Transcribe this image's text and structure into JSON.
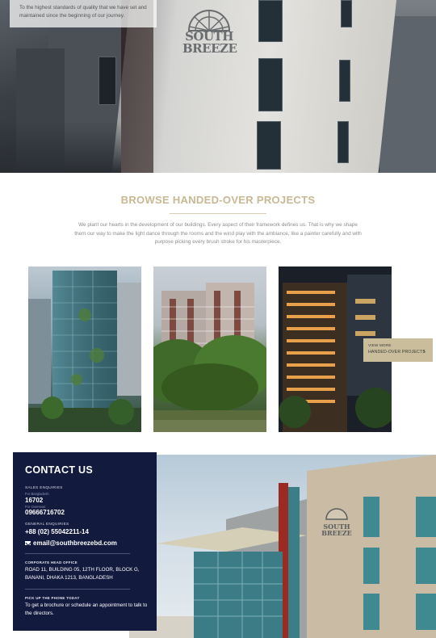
{
  "hero": {
    "caption": "To the highest standards of quality that we have set and maintained since the beginning of our journey.",
    "building_sign": "SOUTH BREEZE"
  },
  "browse": {
    "title": "BROWSE HANDED-OVER PROJECTS",
    "description": "We plant our hearts in the development of our buildings. Every aspect of their framework defines us. That is why we shape them our way to make the light dance through the rooms and the wind play with the ambiance, like a painter carefully and with purpose picking every brush stroke for his masterpiece."
  },
  "view_more": {
    "label_top": "VIEW MORE",
    "label_bottom": "HANDED-OVER PROJECTS",
    "arrow": "›"
  },
  "contact": {
    "title": "CONTACT US",
    "sales_label": "SALES ENQUIRIES",
    "bangladesh_sub": "For Bangladesh",
    "bangladesh_number": "16702",
    "overseas_sub": "For Overseas",
    "overseas_number": "09666716702",
    "general_label": "GENERAL ENQUIRIES",
    "general_number": "+88 (02) 55042211-14",
    "email": "email@southbreezebd.com",
    "office_label": "CORPORATE HEAD OFFICE",
    "office_address": "ROAD 11, BUILDING 05, 12TH FLOOR, BLOCK G, BANANI, DHAKA 1213, BANGLADESH",
    "phone_label": "PICK UP THE PHONE TODAY",
    "phone_text": "To get a brochure or schedule an appointment to talk to the directors."
  },
  "colors": {
    "accent_gold": "#c8b893",
    "navy": "#121a3d",
    "text_gray": "#8d8d8d"
  }
}
